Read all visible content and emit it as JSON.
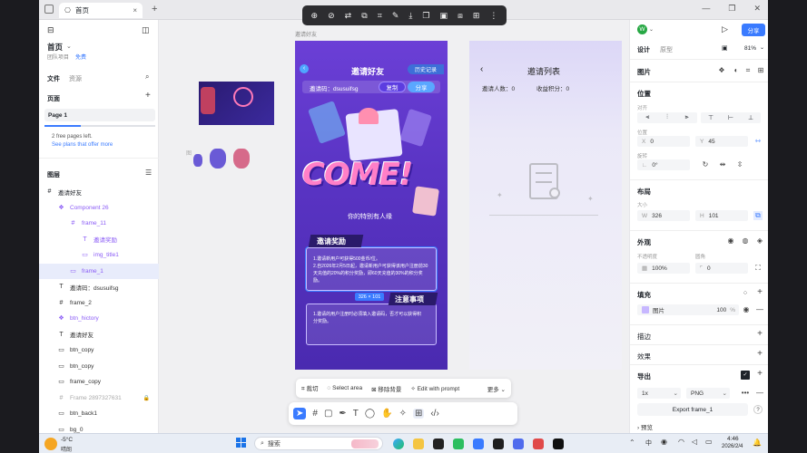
{
  "browser": {
    "tab_title": "首页",
    "tab_close": "×",
    "new_tab": "+",
    "window_controls": [
      "—",
      "❐",
      "✕"
    ]
  },
  "left_panel": {
    "title": "首页",
    "subtitle": "团队项目",
    "plan_badge": "免费",
    "tabs": [
      "文件",
      "资源"
    ],
    "pages_header": "页面",
    "add": "+",
    "current_page": "Page 1",
    "free_pages_text": "2 free pages left.",
    "free_pages_link": "See plans that offer more",
    "layers_header": "图层",
    "layers": [
      {
        "name": "邀请好友",
        "indent": 0,
        "color": "#1f2329",
        "icon": "#"
      },
      {
        "name": "Component 26",
        "indent": 1,
        "color": "#8b5cf6",
        "icon": "❖"
      },
      {
        "name": "frame_11",
        "indent": 2,
        "color": "#8b5cf6",
        "icon": "#"
      },
      {
        "name": "邀请奖励",
        "indent": 3,
        "color": "#8b5cf6",
        "icon": "T"
      },
      {
        "name": "img_title1",
        "indent": 3,
        "color": "#8b5cf6",
        "icon": "▭"
      },
      {
        "name": "frame_1",
        "indent": 2,
        "color": "#8b5cf6",
        "icon": "▭",
        "selected": true
      },
      {
        "name": "邀请码：dsusuifsg",
        "indent": 1,
        "color": "#333",
        "icon": "T"
      },
      {
        "name": "frame_2",
        "indent": 1,
        "color": "#333",
        "icon": "#"
      },
      {
        "name": "btn_hictory",
        "indent": 1,
        "color": "#8b5cf6",
        "icon": "❖"
      },
      {
        "name": "邀请好友",
        "indent": 1,
        "color": "#333",
        "icon": "T"
      },
      {
        "name": "btn_copy",
        "indent": 1,
        "color": "#333",
        "icon": "▭"
      },
      {
        "name": "btn_copy",
        "indent": 1,
        "color": "#333",
        "icon": "▭"
      },
      {
        "name": "frame_copy",
        "indent": 1,
        "color": "#333",
        "icon": "▭"
      },
      {
        "name": "Frame 2897327631",
        "indent": 1,
        "color": "#aaa",
        "icon": "#"
      },
      {
        "name": "btn_back1",
        "indent": 1,
        "color": "#333",
        "icon": "▭"
      },
      {
        "name": "bg_0",
        "indent": 1,
        "color": "#333",
        "icon": "▭"
      }
    ]
  },
  "canvas": {
    "frame_label": "邀请好友",
    "phone1": {
      "title": "邀请好友",
      "history_btn": "历史记录",
      "invite_code": "邀请码：dsusuifsg",
      "copy_btn": "复制",
      "share_btn": "分享",
      "come_text": "COME!",
      "special_text": "你的特别有人缘",
      "reward_title": "邀请奖励",
      "reward_text": "1.邀请新用户可获得500金币/位。\n2.自2026年2月5日起，邀请新用户可获得该用户注册前30天充值的20%的积分奖励，即60天充值的30%的积分奖励。",
      "size_badge": "326 × 101",
      "notice_title": "注意事项",
      "notice_text": "1.邀请的用户注册时必须填入邀请码，否才可以获得积分奖励。"
    },
    "phone2": {
      "title": "邀请列表",
      "invite_count": "邀请人数：0",
      "points": "收益积分：0"
    },
    "bottom_bar": [
      "裁切",
      "Select area",
      "移除背景",
      "Edit with prompt",
      "更多"
    ]
  },
  "right_panel": {
    "avatar": "W",
    "share_btn": "分享",
    "tabs": [
      "设计",
      "原型"
    ],
    "zoom": "81%",
    "section_image": "图片",
    "section_position": "位置",
    "align_label": "对齐",
    "pos_label": "位置",
    "x": "0",
    "y": "45",
    "rotate_label": "旋转",
    "rotation": "0°",
    "section_layout": "布局",
    "size_label": "大小",
    "w": "326",
    "h": "101",
    "section_appearance": "外观",
    "opacity_label": "不透明度",
    "radius_label": "圆角",
    "opacity": "100%",
    "radius": "0",
    "section_fill": "填充",
    "fill_name": "图片",
    "fill_opacity": "100",
    "fill_percent": "%",
    "section_stroke": "描边",
    "section_effects": "效果",
    "section_export": "导出",
    "export_scale": "1x",
    "export_format": "PNG",
    "export_btn": "Export frame_1",
    "preview": "预览"
  },
  "taskbar": {
    "weather_temp": "-5°C",
    "weather_desc": "晴朗",
    "search": "搜索",
    "time": "4:46",
    "date": "2026/2/4",
    "lang": "中"
  },
  "colors": {
    "accent": "#3a7bff",
    "purple": "#8b5cf6"
  }
}
